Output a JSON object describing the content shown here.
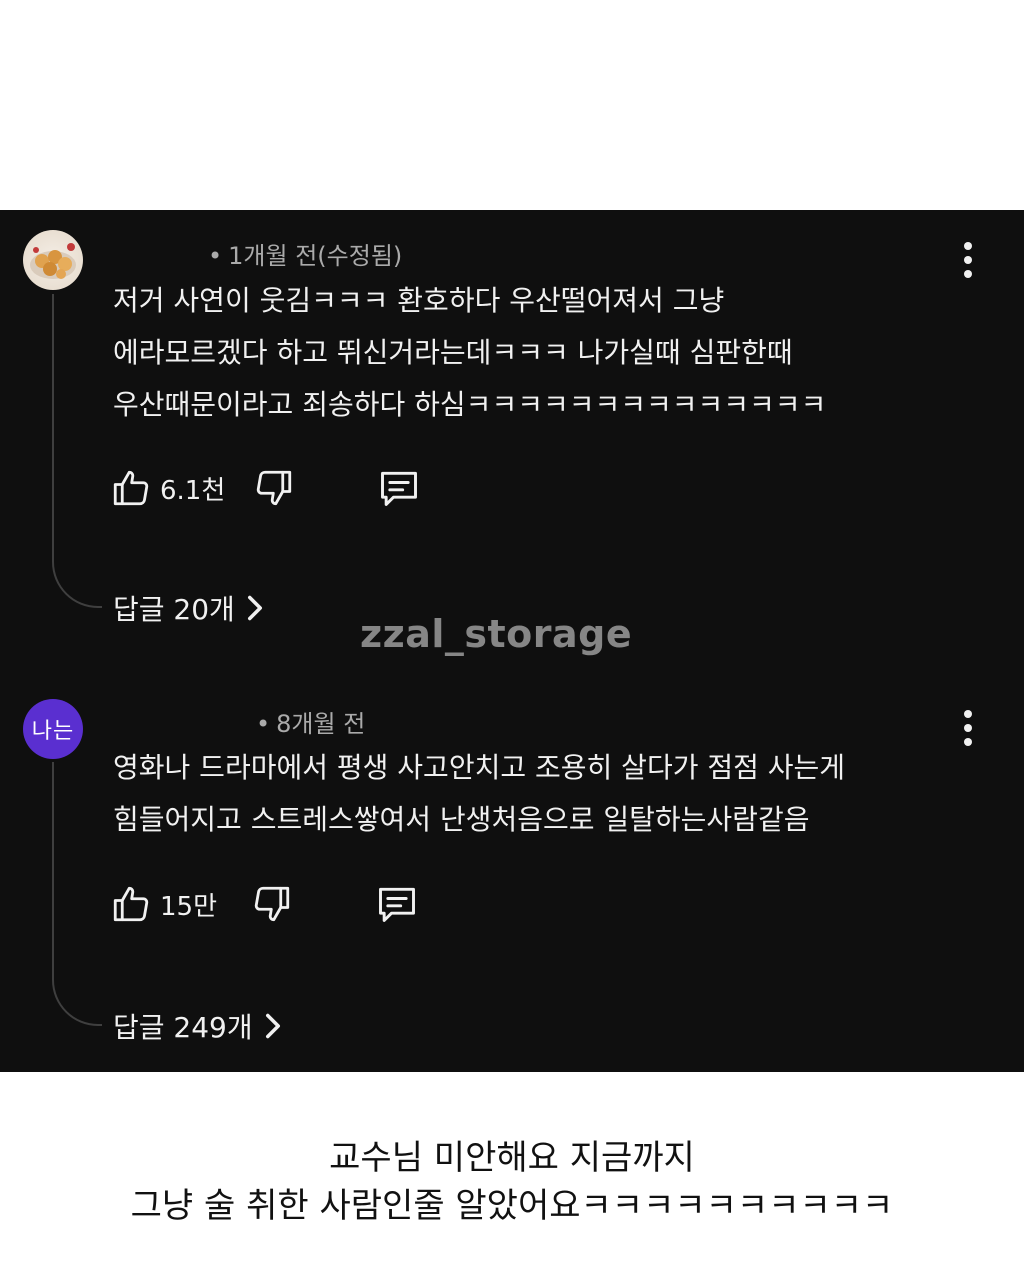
{
  "comments": [
    {
      "avatar": "food-photo-avatar",
      "meta": "1개월 전(수정됨)",
      "lines": [
        "저거 사연이 웃김ㅋㅋㅋ 환호하다 우산떨어져서 그냥",
        "에라모르겠다 하고 뛰신거라는데ㅋㅋㅋ 나가실때 심판한때",
        "우산때문이라고 죄송하다 하심ㅋㅋㅋㅋㅋㅋㅋㅋㅋㅋㅋㅋㅋㅋ"
      ],
      "likes": "6.1천",
      "replies": "답글 20개"
    },
    {
      "avatar_text": "나는",
      "meta": "8개월 전",
      "lines": [
        "영화나 드라마에서 평생 사고안치고 조용히 살다가 점점 사는게",
        "힘들어지고 스트레스쌓여서 난생처음으로 일탈하는사람같음"
      ],
      "likes": "15만",
      "replies": "답글 249개"
    }
  ],
  "watermark": "zzal_storage",
  "caption": [
    "교수님 미안해요 지금까지",
    "그냥 술 취한 사람인줄 알았어요ㅋㅋㅋㅋㅋㅋㅋㅋㅋㅋ"
  ],
  "colors": {
    "panel_bg": "#0f0f0f",
    "text": "#f1f1f1",
    "meta": "#aaaaaa",
    "avatar_purple": "#5a2fd0"
  },
  "icons": [
    "more-vert-icon",
    "thumb-up-icon",
    "thumb-down-icon",
    "reply-comment-icon",
    "chevron-right-icon"
  ]
}
